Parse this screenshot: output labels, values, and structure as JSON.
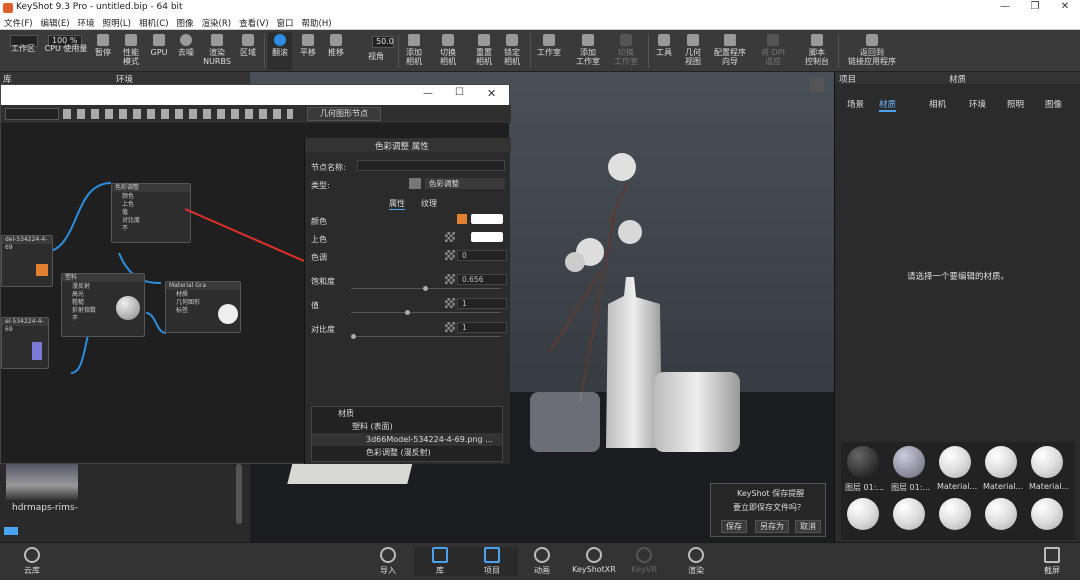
{
  "window": {
    "title": "KeyShot 9.3 Pro - untitled.bip - 64 bit",
    "controls": [
      "—",
      "❐",
      "✕"
    ]
  },
  "menu": [
    "文件(F)",
    "编辑(E)",
    "环境",
    "照明(L)",
    "相机(C)",
    "图像",
    "渲染(R)",
    "查看(V)",
    "窗口",
    "帮助(H)"
  ],
  "toolbar": {
    "zoom_value": "100 %",
    "fov_value": "50.0",
    "items": [
      {
        "label": "工作区"
      },
      {
        "label": "CPU 使用量"
      },
      {
        "label": "暂停"
      },
      {
        "label": "性能\n模式"
      },
      {
        "label": "GPU"
      },
      {
        "label": "去噪"
      },
      {
        "label": "渲染\nNURBS"
      },
      {
        "label": "区域"
      },
      {
        "label": "翻滚"
      },
      {
        "label": "平移"
      },
      {
        "label": "推移"
      },
      {
        "label": "视角"
      },
      {
        "label": "添加\n相机"
      },
      {
        "label": "切换\n相机"
      },
      {
        "label": "重置\n相机"
      },
      {
        "label": "锁定\n相机"
      },
      {
        "label": "工作室"
      },
      {
        "label": "添加\n工作室"
      },
      {
        "label": "切换\n工作室"
      },
      {
        "label": "工具"
      },
      {
        "label": "几何\n视图"
      },
      {
        "label": "配置程序\n向导"
      },
      {
        "label": "将 DPI\n适应"
      },
      {
        "label": "脚本\n控制台"
      },
      {
        "label": "返回到\n链接应用程序"
      }
    ]
  },
  "left_panel": {
    "title": "库",
    "tab": "环境",
    "thumb_label": "hdrmaps-rims-"
  },
  "node_window": {
    "breadcrumb": "几何图形节点",
    "nodes": [
      {
        "title": "色彩调整",
        "pins": [
          "颜色",
          "上色",
          "值",
          "对比度",
          "不"
        ]
      },
      {
        "title": "塑料",
        "pins": [
          "漫反射",
          "高光",
          "粗糙",
          "折射指数",
          "不"
        ]
      },
      {
        "title": "Material Gra",
        "pins": [
          "材质",
          "几何图形",
          "标签"
        ]
      },
      {
        "title": "del-534224-4-69",
        "pins": []
      },
      {
        "title": "el-534224-4-69",
        "pins": []
      }
    ]
  },
  "props": {
    "title": "色彩调整 属性",
    "node_name_label": "节点名称:",
    "type_label": "类型:",
    "type_value": "色彩调整",
    "tabs": [
      "属性",
      "纹理"
    ],
    "rows": [
      {
        "label": "颜色",
        "value": ""
      },
      {
        "label": "上色",
        "value": ""
      },
      {
        "label": "色调",
        "value": "0"
      },
      {
        "label": "饱和度",
        "value": "0.656"
      },
      {
        "label": "值",
        "value": "1"
      },
      {
        "label": "对比度",
        "value": "1"
      }
    ],
    "tree": [
      {
        "label": "材质"
      },
      {
        "label": "塑料 (表面)"
      },
      {
        "label": "3d66Model-534224-4-69.png ..."
      },
      {
        "label": "色彩调整 (漫反射)"
      }
    ]
  },
  "reminder": {
    "title": "KeyShot 保存提醒",
    "message": "要立即保存文件吗？",
    "buttons": [
      "保存",
      "另存为",
      "取消"
    ]
  },
  "right_panel": {
    "left_title": "项目",
    "title": "材质",
    "tabs": [
      "场景",
      "材质",
      "相机",
      "环境",
      "照明",
      "图像"
    ],
    "empty_message": "请选择一个要编辑的材质。",
    "materials": [
      "图层 01:...",
      "图层 01:...",
      "Material...",
      "Material...",
      "Material..."
    ]
  },
  "bottom": {
    "items": [
      "云库",
      "导入",
      "库",
      "项目",
      "动画",
      "KeyShotXR",
      "KeyVR",
      "渲染",
      "截屏"
    ]
  },
  "colors": {
    "accent": "#2a8ee0",
    "arrow": "#e0302a"
  }
}
